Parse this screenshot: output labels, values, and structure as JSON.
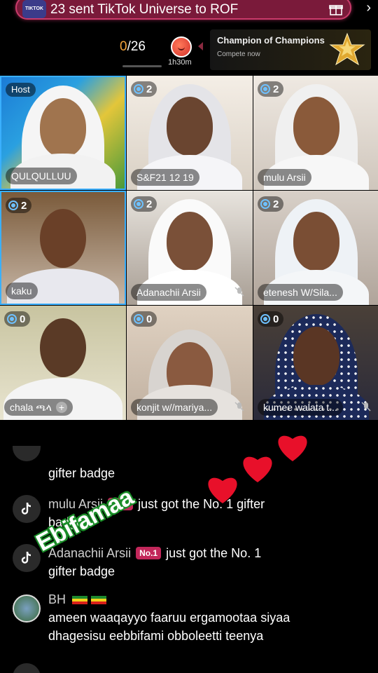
{
  "banner": {
    "logo_text": "TIKTOK",
    "text": "23 sent TikTok Universe to ROF",
    "accent": "#c93a6a"
  },
  "stats": {
    "count_current": "0",
    "count_total": "/26",
    "timer": "1h30m"
  },
  "champion": {
    "title": "Champion of Champions",
    "subtitle": "Compete now"
  },
  "tiles": [
    {
      "badge": "Host",
      "name": "QULQULLUU",
      "host": true,
      "muted": false
    },
    {
      "badge": "2",
      "name": "S&F21 12 19",
      "host": false,
      "muted": false
    },
    {
      "badge": "2",
      "name": "mulu Arsii",
      "host": false,
      "muted": false
    },
    {
      "badge": "2",
      "name": "kaku",
      "host": false,
      "muted": false
    },
    {
      "badge": "2",
      "name": "Adanachii  Arsii",
      "host": false,
      "muted": true
    },
    {
      "badge": "2",
      "name": "etenesh W/Sila...",
      "host": false,
      "muted": false
    },
    {
      "badge": "0",
      "name": "chala ጫላ",
      "host": false,
      "muted": false,
      "plus": "+"
    },
    {
      "badge": "0",
      "name": "konjit w//mariya...",
      "host": false,
      "muted": true
    },
    {
      "badge": "0",
      "name": "kumee walata t...",
      "host": false,
      "muted": true
    }
  ],
  "comments": {
    "c0_text": "gifter badge",
    "c1_name": "mulu Arsii",
    "c1_badge": "No.1",
    "c1_text_a": "just got the No. 1 gifter",
    "c1_text_b": "badge",
    "c2_name": "Adanachii Arsii",
    "c2_badge": "No.1",
    "c2_text_a": "just got the No. 1",
    "c2_text_b": "gifter badge",
    "c3_name": "BH",
    "c3_text_a": "ameen waaqayyo faaruu ergamootaa siyaa",
    "c3_text_b": "dhagesisu eebbifami obboleetti teenya"
  },
  "overlay": {
    "text": "Ebifamaa",
    "heart_color": "#e8102a"
  },
  "icons": [
    "gift-icon",
    "chevron-right-icon",
    "tiktok-logo-icon",
    "mute-icon",
    "eye-icon",
    "heart-icon"
  ]
}
